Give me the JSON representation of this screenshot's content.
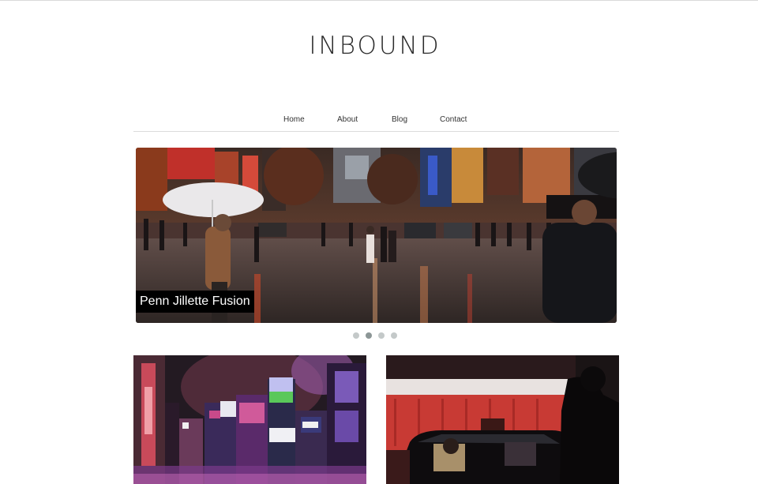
{
  "site": {
    "title": "INBOUND"
  },
  "nav": {
    "items": [
      {
        "label": "Home"
      },
      {
        "label": "About"
      },
      {
        "label": "Blog"
      },
      {
        "label": "Contact"
      }
    ]
  },
  "slider": {
    "caption": "Penn Jillette Fusion",
    "slide_count": 4,
    "active_slide": 2
  },
  "posts": [
    {
      "image": "night-city-billboards-photo"
    },
    {
      "image": "taxi-red-light-photo"
    }
  ],
  "colors": {
    "text": "#2b2b2b",
    "rule": "#dcdcdc",
    "dot": "#c4c9c9",
    "dot_active": "#8c9696",
    "caption_bg": "#000000"
  }
}
